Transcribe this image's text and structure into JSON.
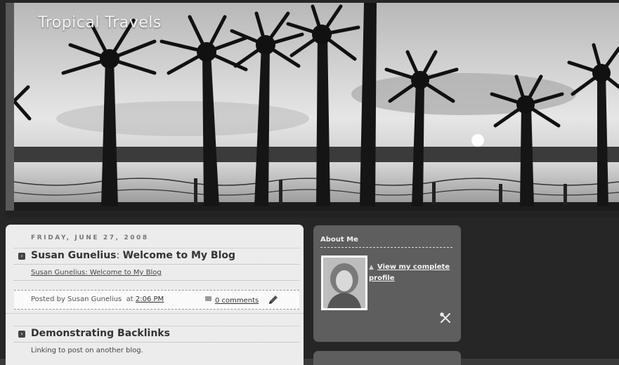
{
  "header": {
    "blog_title": "Tropical Travels"
  },
  "posts": [
    {
      "date": "FRIDAY, JUNE 27, 2008",
      "title_prefix": "Susan Gunelius",
      "title_sep": ": ",
      "title_rest": "Welcome to My Blog",
      "body": "Susan Gunelius: Welcome to My Blog",
      "posted_by": "Posted by Susan Gunelius  at ",
      "posted_time": "2:06 PM",
      "comments": "0 comments"
    },
    {
      "title": "Demonstrating Backlinks",
      "body": "Linking to post on another blog."
    }
  ],
  "sidebar": {
    "about_title": "About Me",
    "profile_link": "View my complete profile"
  },
  "icons": {
    "post_arrow": "arrow-right-box-icon",
    "comment": "speech-bubble-icon",
    "edit": "pencil-icon",
    "person": "person-icon",
    "tools": "screwdriver-wrench-icon"
  }
}
